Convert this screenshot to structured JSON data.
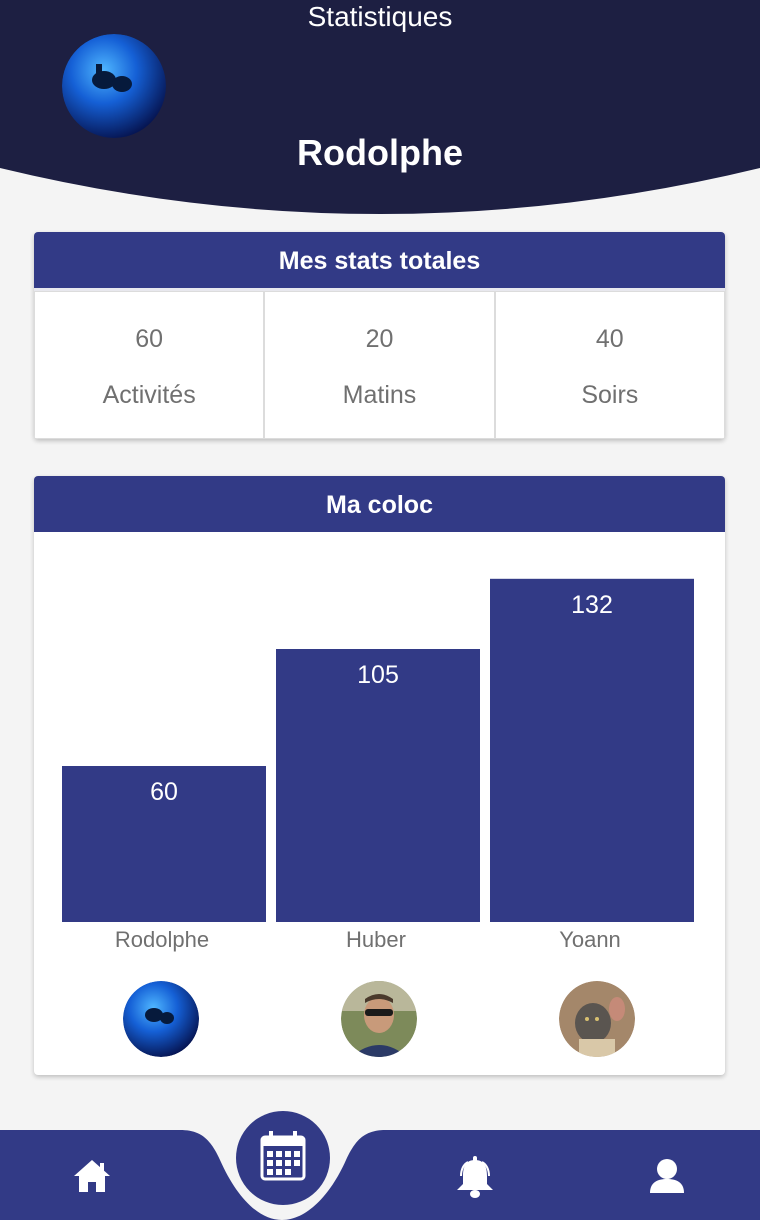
{
  "header": {
    "title": "Statistiques",
    "user_name": "Rodolphe",
    "background_color": "#1d1f42"
  },
  "total_stats": {
    "title": "Mes stats totales",
    "items": [
      {
        "value": "60",
        "label": "Activités"
      },
      {
        "value": "20",
        "label": "Matins"
      },
      {
        "value": "40",
        "label": "Soirs"
      }
    ]
  },
  "coloc": {
    "title": "Ma coloc",
    "bar_color": "#323a86"
  },
  "chart_data": {
    "type": "bar",
    "title": "",
    "xlabel": "",
    "ylabel": "",
    "categories": [
      "Rodolphe",
      "Huber",
      "Yoann"
    ],
    "values": [
      60,
      105,
      132
    ],
    "ylim": [
      0,
      150
    ],
    "grid": false
  },
  "bottom_nav": {
    "items": [
      {
        "icon": "home-icon"
      },
      {
        "icon": "calendar-icon",
        "active": true
      },
      {
        "icon": "bell-icon"
      },
      {
        "icon": "user-icon"
      }
    ],
    "color": "#323a86"
  }
}
